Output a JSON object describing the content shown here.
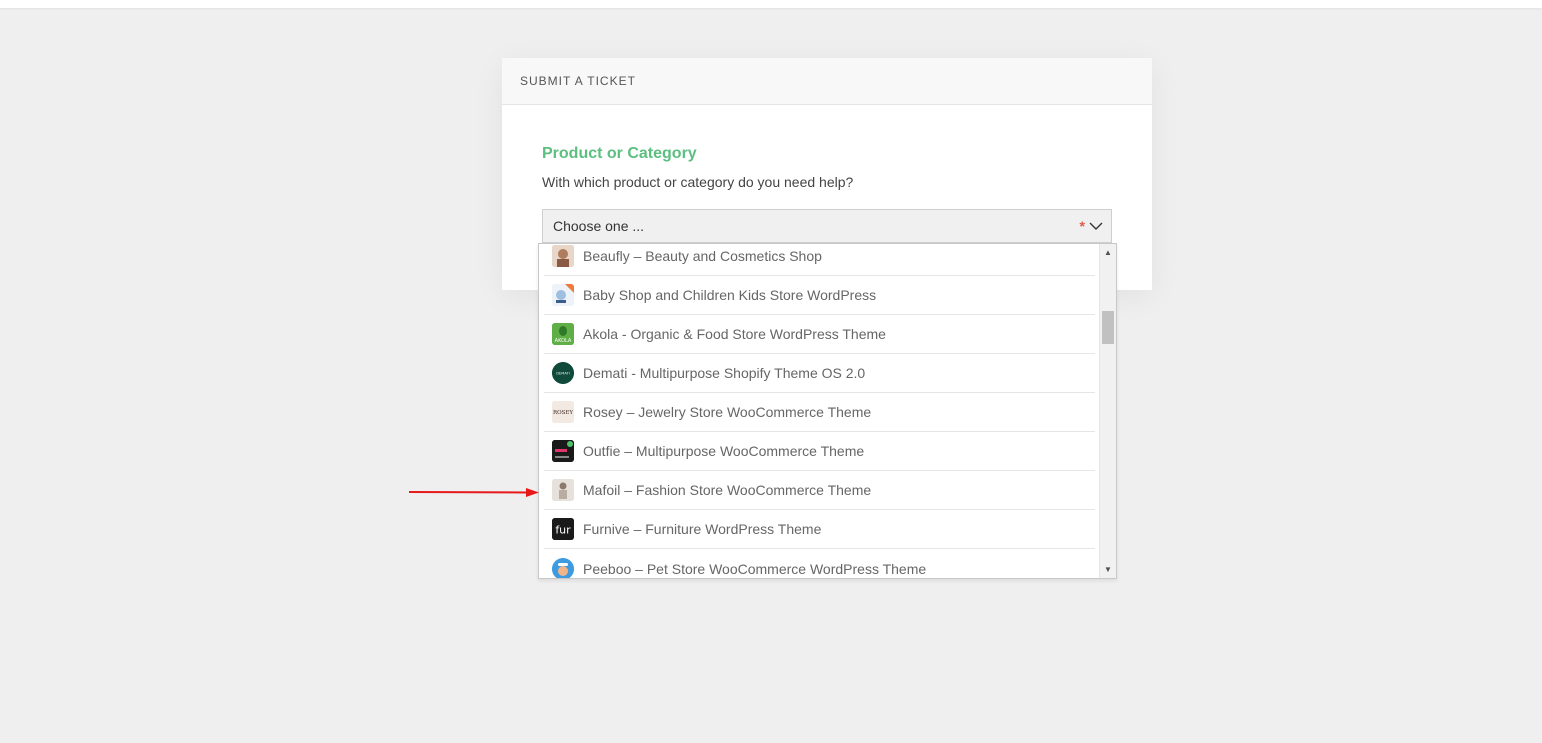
{
  "header": {
    "title": "SUBMIT A TICKET"
  },
  "field": {
    "title": "Product or Category",
    "description": "With which product or category do you need help?",
    "select_value": "Choose one ...",
    "required_mark": "*"
  },
  "dropdown": {
    "items": [
      {
        "label": "Beaufly – Beauty and Cosmetics Shop",
        "icon": "beaufly-thumbnail-icon",
        "color": "#c9a58f"
      },
      {
        "label": "Baby Shop and Children Kids Store WordPress",
        "icon": "babyshop-thumbnail-icon",
        "color": "#dfe9f4"
      },
      {
        "label": "Akola - Organic & Food Store WordPress Theme",
        "icon": "akola-thumbnail-icon",
        "color": "#5fae46"
      },
      {
        "label": "Demati - Multipurpose Shopify Theme OS 2.0",
        "icon": "demati-thumbnail-icon",
        "color": "#0f4a3a"
      },
      {
        "label": "Rosey – Jewelry Store WooCommerce Theme",
        "icon": "rosey-thumbnail-icon",
        "color": "#efe4dc"
      },
      {
        "label": "Outfie – Multipurpose WooCommerce Theme",
        "icon": "outfie-thumbnail-icon",
        "color": "#1a1a1a"
      },
      {
        "label": "Mafoil – Fashion Store WooCommerce Theme",
        "icon": "mafoil-thumbnail-icon",
        "color": "#d8d2cb"
      },
      {
        "label": "Furnive – Furniture WordPress Theme",
        "icon": "furnive-thumbnail-icon",
        "color": "#1a1a1a"
      },
      {
        "label": "Peeboo – Pet Store WooCommerce WordPress Theme",
        "icon": "peeboo-thumbnail-icon",
        "color": "#3f9be0"
      }
    ]
  },
  "thumb_text": {
    "demati": "DEMATI",
    "rosey": "ROSEY",
    "akola": "AKOLA",
    "furnive": "fur"
  },
  "colors": {
    "accent": "#5cbf7f",
    "required": "#e05a47",
    "annotation_arrow": "#e8191a"
  }
}
